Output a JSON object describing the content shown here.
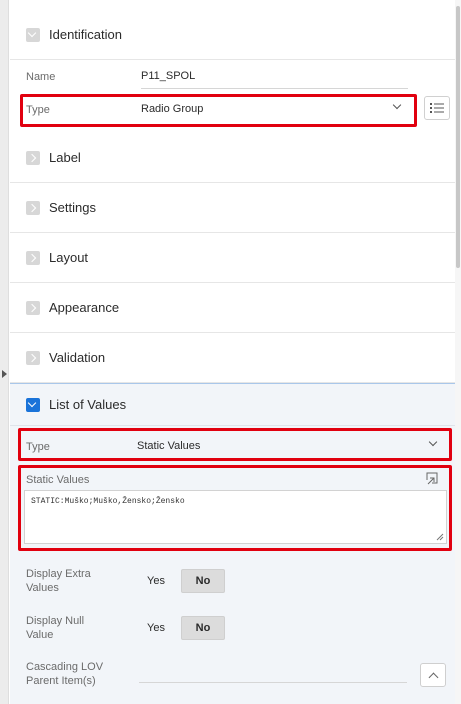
{
  "identification": {
    "title": "Identification",
    "name_label": "Name",
    "name_value": "P11_SPOL",
    "type_label": "Type",
    "type_value": "Radio Group"
  },
  "sections": [
    {
      "title": "Label"
    },
    {
      "title": "Settings"
    },
    {
      "title": "Layout"
    },
    {
      "title": "Appearance"
    },
    {
      "title": "Validation"
    }
  ],
  "list_of_values": {
    "title": "List of Values",
    "type_label": "Type",
    "type_value": "Static Values",
    "static_values_label": "Static Values",
    "static_values_text": "STATIC:Muško;Muško,Žensko;Žensko",
    "display_extra_label": "Display Extra Values",
    "display_extra_yes": "Yes",
    "display_extra_no": "No",
    "display_null_label": "Display Null Value",
    "display_null_yes": "Yes",
    "display_null_no": "No",
    "cascading_label": "Cascading LOV Parent Item(s)",
    "cascading_value": ""
  },
  "colors": {
    "highlight": "#e1000f",
    "accent": "#1a73d9",
    "lov_background": "#f2f5f9"
  }
}
